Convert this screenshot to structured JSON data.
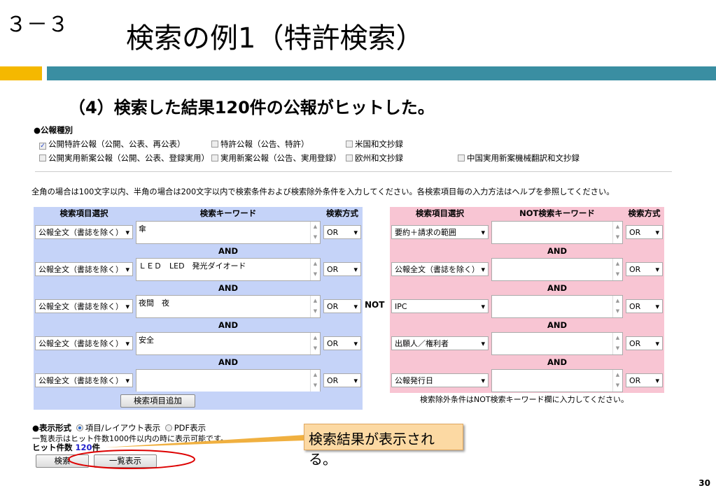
{
  "slide": {
    "section": "３－３",
    "title": "検索の例1（特許検索）",
    "subtitle": "（4）検索した結果120件の公報がヒットした。",
    "page": "30",
    "callout": "検索結果が表示される。"
  },
  "pubtypes": {
    "heading": "●公報種別",
    "items": [
      {
        "label": "公開特許公報（公開、公表、再公表）",
        "checked": true
      },
      {
        "label": "特許公報（公告、特許）",
        "checked": false
      },
      {
        "label": "米国和文抄録",
        "checked": false
      },
      {
        "label": "公開実用新案公報（公開、公表、登録実用）",
        "checked": false
      },
      {
        "label": "実用新案公報（公告、実用登録）",
        "checked": false
      },
      {
        "label": "欧州和文抄録",
        "checked": false
      },
      {
        "label": "中国実用新案機械翻訳和文抄録",
        "checked": false
      }
    ]
  },
  "instructions": "全角の場合は100文字以内、半角の場合は200文字以内で検索条件および検索除外条件を入力してください。各検索項目毎の入力方法はヘルプを参照してください。",
  "left": {
    "headers": [
      "検索項目選択",
      "検索キーワード",
      "検索方式"
    ],
    "rows": [
      {
        "field": "公報全文（書誌を除く）",
        "keyword": "傘",
        "method": "OR"
      },
      {
        "field": "公報全文（書誌を除く）",
        "keyword": "ＬＥＤ　LED　発光ダイオード",
        "method": "OR"
      },
      {
        "field": "公報全文（書誌を除く）",
        "keyword": "夜間　夜",
        "method": "OR"
      },
      {
        "field": "公報全文（書誌を除く）",
        "keyword": "安全",
        "method": "OR"
      },
      {
        "field": "公報全文（書誌を除く）",
        "keyword": "",
        "method": "OR"
      }
    ],
    "and": "AND",
    "add_button": "検索項目追加"
  },
  "not_label": "NOT",
  "right": {
    "headers": [
      "検索項目選択",
      "NOT検索キーワード",
      "検索方式"
    ],
    "rows": [
      {
        "field": "要約＋請求の範囲",
        "keyword": "",
        "method": "OR"
      },
      {
        "field": "公報全文（書誌を除く）",
        "keyword": "",
        "method": "OR"
      },
      {
        "field": "IPC",
        "keyword": "",
        "method": "OR"
      },
      {
        "field": "出願人／権利者",
        "keyword": "",
        "method": "OR"
      },
      {
        "field": "公報発行日",
        "keyword": "",
        "method": "OR"
      }
    ],
    "and": "AND",
    "note": "検索除外条件はNOT検索キーワード欄に入力してください。"
  },
  "display": {
    "heading": "●表示形式",
    "opt1": "項目/レイアウト表示",
    "opt2": "PDF表示",
    "note": "一覧表示はヒット件数1000件以内の時に表示可能です。",
    "hits_label": "ヒット件数",
    "hits_value": "120",
    "hits_unit": "件",
    "search_button": "検索",
    "list_button": "一覧表示"
  },
  "colors": {
    "left_bg": "#c5d3f8",
    "right_bg": "#f8c5d3",
    "accent_bar": "#3a8ea2",
    "orange": "#f5b800"
  }
}
